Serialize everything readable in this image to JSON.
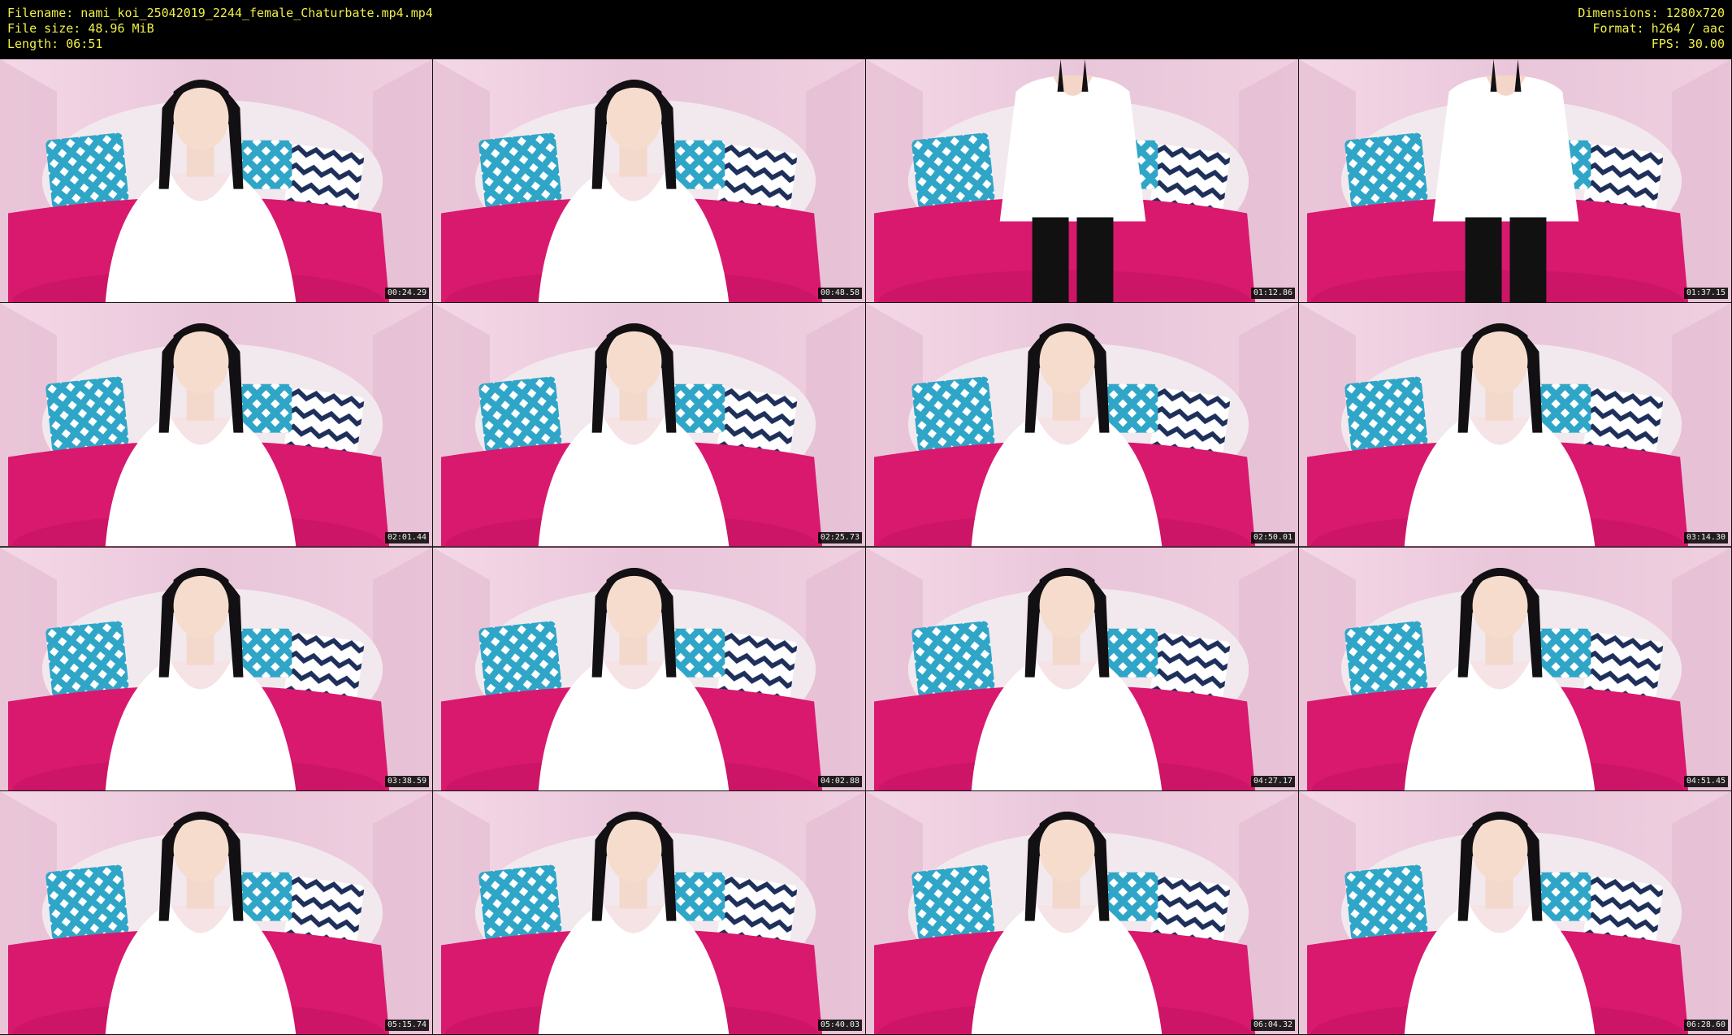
{
  "header": {
    "left": [
      "Filename: nami_koi_25042019_2244_female_Chaturbate.mp4.mp4",
      "File size: 48.96 MiB",
      "Length: 06:51"
    ],
    "right": [
      "Dimensions: 1280x720",
      "Format: h264 / aac",
      "FPS: 30.00"
    ]
  },
  "colors": {
    "text": "#f0f04a",
    "wall": "#e9c6da",
    "bed": "#d8196e",
    "headboard": "#f2e9ee",
    "pillow_blue": "#2fa6c8",
    "pillow_navy": "#1d2f5a",
    "shirt": "#ffffff",
    "hair": "#121012"
  },
  "thumbnails": [
    {
      "time": "00:24.29",
      "pose": "seated"
    },
    {
      "time": "00:48.58",
      "pose": "seated"
    },
    {
      "time": "01:12.86",
      "pose": "standing"
    },
    {
      "time": "01:37.15",
      "pose": "standing"
    },
    {
      "time": "02:01.44",
      "pose": "seated"
    },
    {
      "time": "02:25.73",
      "pose": "seated"
    },
    {
      "time": "02:50.01",
      "pose": "seated"
    },
    {
      "time": "03:14.30",
      "pose": "seated"
    },
    {
      "time": "03:38.59",
      "pose": "seated"
    },
    {
      "time": "04:02.88",
      "pose": "seated"
    },
    {
      "time": "04:27.17",
      "pose": "seated"
    },
    {
      "time": "04:51.45",
      "pose": "seated"
    },
    {
      "time": "05:15.74",
      "pose": "seated"
    },
    {
      "time": "05:40.03",
      "pose": "seated"
    },
    {
      "time": "06:04.32",
      "pose": "seated"
    },
    {
      "time": "06:28.60",
      "pose": "seated"
    }
  ]
}
